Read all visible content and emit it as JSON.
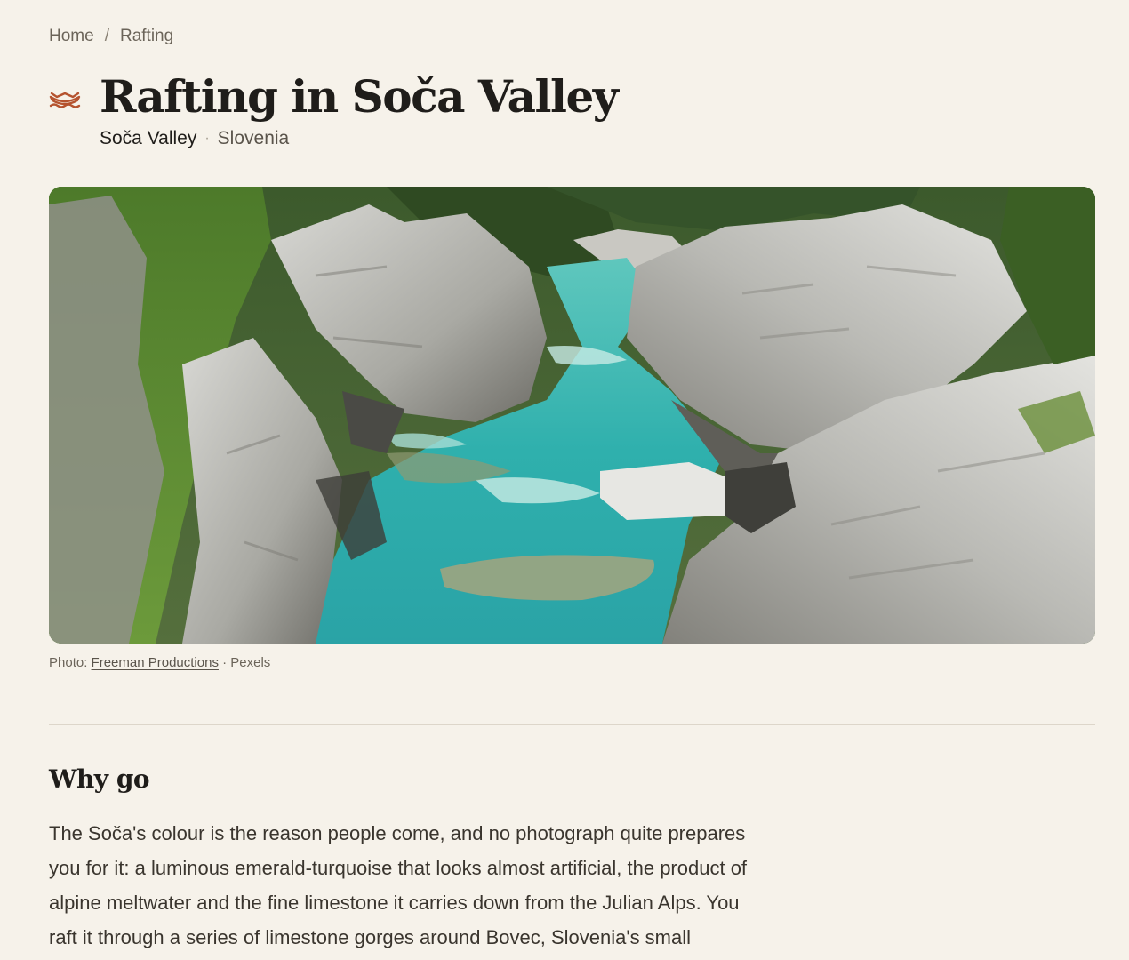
{
  "breadcrumb": {
    "home": "Home",
    "separator": "/",
    "current": "Rafting"
  },
  "header": {
    "icon": "raft-icon",
    "title": "Rafting in Soča Valley",
    "region": "Soča Valley",
    "separator": "·",
    "country": "Slovenia"
  },
  "hero": {
    "alt": "Turquoise Soča river flowing through a limestone gorge"
  },
  "credit": {
    "prefix": "Photo: ",
    "author": "Freeman Productions",
    "suffix": " · Pexels"
  },
  "section": {
    "heading": "Why go",
    "body": "The Soča's colour is the reason people come, and no photograph quite prepares you for it: a luminous emerald-turquoise that looks almost artificial, the product of alpine meltwater and the fine limestone it carries down from the Julian Alps. You raft it through a series of limestone gorges around Bovec, Slovenia's small"
  },
  "colors": {
    "background": "#f6f2ea",
    "accent": "#b5532f",
    "text": "#1f1d1a",
    "muted": "#6b6459",
    "river": "#3fbcb9"
  }
}
